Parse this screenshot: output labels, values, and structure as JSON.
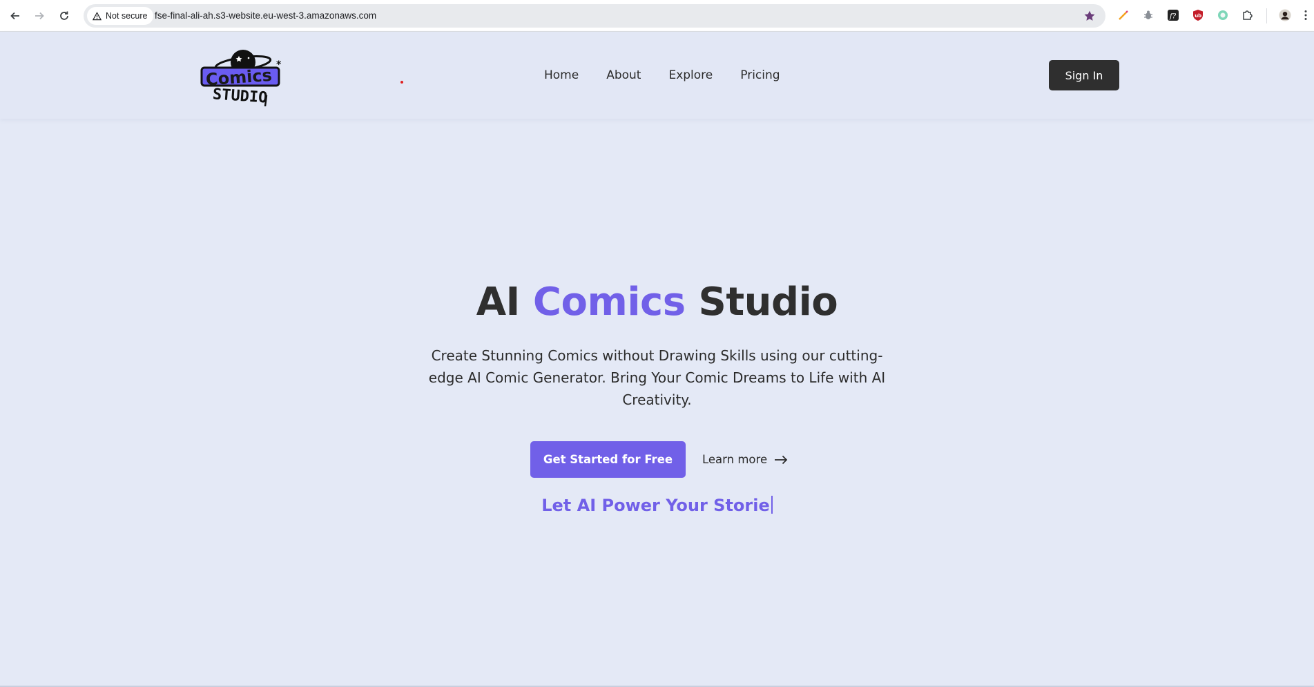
{
  "browser": {
    "security_label": "Not secure",
    "url": "fse-final-ali-ah.s3-website.eu-west-3.amazonaws.com"
  },
  "header": {
    "logo_alt": "Comics Studio",
    "nav": [
      {
        "label": "Home"
      },
      {
        "label": "About"
      },
      {
        "label": "Explore"
      },
      {
        "label": "Pricing"
      }
    ],
    "signin_label": "Sign In"
  },
  "hero": {
    "title_part1": "AI ",
    "title_accent": "Comics",
    "title_part2": " Studio",
    "subtitle": "Create Stunning Comics without Drawing Skills using our cutting-edge AI Comic Generator. Bring Your Comic Dreams to Life with AI Creativity.",
    "cta_primary": "Get Started for Free",
    "cta_secondary": "Learn more",
    "typed_text": "Let AI Power Your Storie"
  },
  "colors": {
    "accent": "#7160e8",
    "dark_button": "#2f2f2f",
    "background": "#e4e9f6"
  }
}
